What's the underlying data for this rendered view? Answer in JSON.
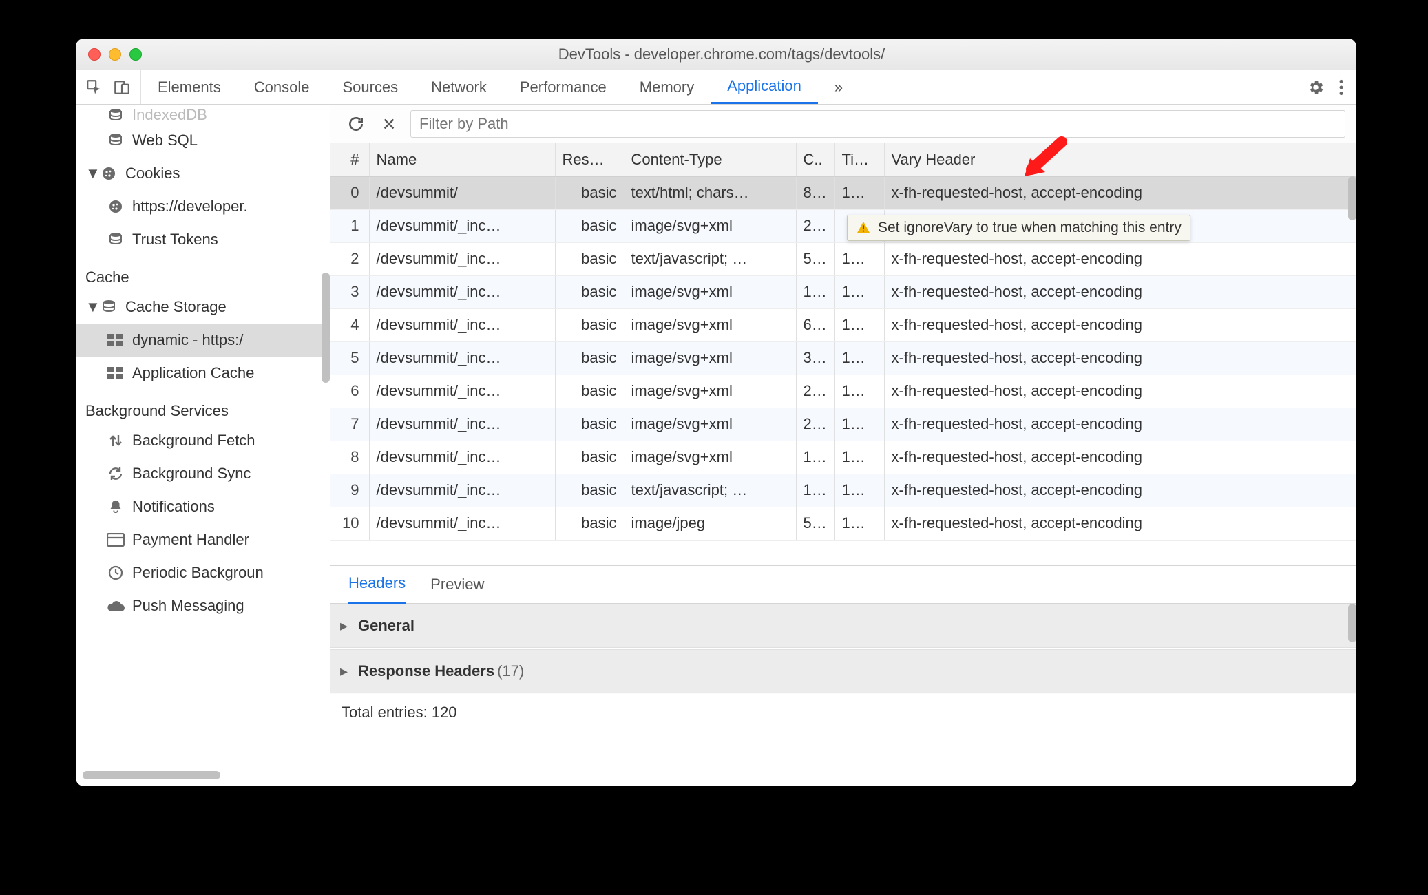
{
  "window": {
    "title": "DevTools - developer.chrome.com/tags/devtools/"
  },
  "tabs": {
    "items": [
      "Elements",
      "Console",
      "Sources",
      "Network",
      "Performance",
      "Memory",
      "Application"
    ],
    "active": "Application"
  },
  "sidebar": {
    "items": [
      {
        "type": "item",
        "depth": 1,
        "icon": "db",
        "label": "IndexedDB",
        "cut": true
      },
      {
        "type": "item",
        "depth": 1,
        "icon": "db",
        "label": "Web SQL"
      },
      {
        "type": "item",
        "depth": 0,
        "icon": "cookie",
        "label": "Cookies",
        "expandable": true,
        "expanded": true
      },
      {
        "type": "item",
        "depth": 1,
        "icon": "cookie",
        "label": "https://developer."
      },
      {
        "type": "item",
        "depth": 1,
        "icon": "db",
        "label": "Trust Tokens"
      },
      {
        "type": "header",
        "label": "Cache"
      },
      {
        "type": "item",
        "depth": 0,
        "icon": "db",
        "label": "Cache Storage",
        "expandable": true,
        "expanded": true
      },
      {
        "type": "item",
        "depth": 1,
        "icon": "grid",
        "label": "dynamic - https:/",
        "selected": true
      },
      {
        "type": "item",
        "depth": 1,
        "icon": "grid",
        "label": "Application Cache"
      },
      {
        "type": "header",
        "label": "Background Services"
      },
      {
        "type": "item",
        "depth": 1,
        "icon": "updown",
        "label": "Background Fetch"
      },
      {
        "type": "item",
        "depth": 1,
        "icon": "sync",
        "label": "Background Sync"
      },
      {
        "type": "item",
        "depth": 1,
        "icon": "bell",
        "label": "Notifications"
      },
      {
        "type": "item",
        "depth": 1,
        "icon": "card",
        "label": "Payment Handler"
      },
      {
        "type": "item",
        "depth": 1,
        "icon": "clock",
        "label": "Periodic Backgroun"
      },
      {
        "type": "item",
        "depth": 1,
        "icon": "cloud",
        "label": "Push Messaging"
      }
    ]
  },
  "filter": {
    "placeholder": "Filter by Path"
  },
  "columns": {
    "index": "#",
    "name": "Name",
    "response": "Res…",
    "contentType": "Content-Type",
    "contentLen": "C..",
    "time": "Ti…",
    "vary": "Vary Header"
  },
  "rows": [
    {
      "i": "0",
      "name": "/devsummit/",
      "res": "basic",
      "ct": "text/html; chars…",
      "cl": "8…",
      "ti": "1…",
      "vary": "x-fh-requested-host, accept-encoding",
      "selected": true
    },
    {
      "i": "1",
      "name": "/devsummit/_inc…",
      "res": "basic",
      "ct": "image/svg+xml",
      "cl": "2…",
      "ti": "",
      "vary": ""
    },
    {
      "i": "2",
      "name": "/devsummit/_inc…",
      "res": "basic",
      "ct": "text/javascript; …",
      "cl": "5…",
      "ti": "1…",
      "vary": "x-fh-requested-host, accept-encoding"
    },
    {
      "i": "3",
      "name": "/devsummit/_inc…",
      "res": "basic",
      "ct": "image/svg+xml",
      "cl": "1…",
      "ti": "1…",
      "vary": "x-fh-requested-host, accept-encoding"
    },
    {
      "i": "4",
      "name": "/devsummit/_inc…",
      "res": "basic",
      "ct": "image/svg+xml",
      "cl": "6…",
      "ti": "1…",
      "vary": "x-fh-requested-host, accept-encoding"
    },
    {
      "i": "5",
      "name": "/devsummit/_inc…",
      "res": "basic",
      "ct": "image/svg+xml",
      "cl": "3…",
      "ti": "1…",
      "vary": "x-fh-requested-host, accept-encoding"
    },
    {
      "i": "6",
      "name": "/devsummit/_inc…",
      "res": "basic",
      "ct": "image/svg+xml",
      "cl": "2…",
      "ti": "1…",
      "vary": "x-fh-requested-host, accept-encoding"
    },
    {
      "i": "7",
      "name": "/devsummit/_inc…",
      "res": "basic",
      "ct": "image/svg+xml",
      "cl": "2…",
      "ti": "1…",
      "vary": "x-fh-requested-host, accept-encoding"
    },
    {
      "i": "8",
      "name": "/devsummit/_inc…",
      "res": "basic",
      "ct": "image/svg+xml",
      "cl": "1…",
      "ti": "1…",
      "vary": "x-fh-requested-host, accept-encoding"
    },
    {
      "i": "9",
      "name": "/devsummit/_inc…",
      "res": "basic",
      "ct": "text/javascript; …",
      "cl": "1…",
      "ti": "1…",
      "vary": "x-fh-requested-host, accept-encoding"
    },
    {
      "i": "10",
      "name": "/devsummit/_inc…",
      "res": "basic",
      "ct": "image/jpeg",
      "cl": "5…",
      "ti": "1…",
      "vary": "x-fh-requested-host, accept-encoding"
    }
  ],
  "tooltip": {
    "text": "Set ignoreVary to true when matching this entry"
  },
  "details": {
    "tabs": {
      "items": [
        "Headers",
        "Preview"
      ],
      "active": "Headers"
    },
    "sections": {
      "general": "General",
      "responseHeaders": "Response Headers",
      "responseHeadersCount": "(17)"
    },
    "footer": "Total entries: 120"
  }
}
